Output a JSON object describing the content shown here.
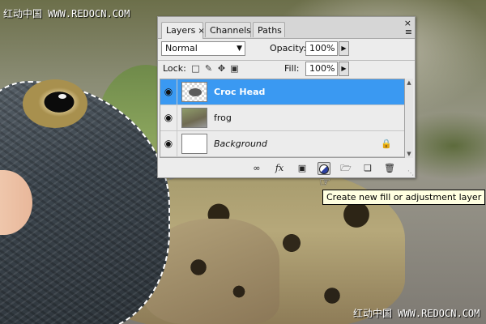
{
  "watermark": {
    "top": "红动中国 WWW.REDOCN.COM",
    "bottom": "红动中国 WWW.REDOCN.COM"
  },
  "tabs": [
    {
      "label": "Layers",
      "close": "×"
    },
    {
      "label": "Channels"
    },
    {
      "label": "Paths"
    }
  ],
  "panel_controls": {
    "collapse": "«",
    "close": "×",
    "menu": "≡"
  },
  "blend_mode": {
    "value": "Normal",
    "arrow": "▼"
  },
  "opacity": {
    "label": "Opacity:",
    "value": "100%",
    "arrow": "▶"
  },
  "lock": {
    "label": "Lock:",
    "icons": [
      "lock-transparent-icon",
      "lock-image-icon",
      "lock-position-icon",
      "lock-all-icon"
    ]
  },
  "fill": {
    "label": "Fill:",
    "value": "100%",
    "arrow": "▶"
  },
  "layers": [
    {
      "name": "Croc Head",
      "selected": true,
      "visible": true
    },
    {
      "name": "frog",
      "selected": false,
      "visible": true
    },
    {
      "name": "Background",
      "selected": false,
      "visible": true,
      "locked": true
    }
  ],
  "bottom_icons": [
    "link-layers-icon",
    "fx-icon",
    "layer-mask-icon",
    "adjustment-layer-icon",
    "new-group-icon",
    "new-layer-icon",
    "trash-icon"
  ],
  "tooltip": "Create new fill or adjustment layer",
  "colors": {
    "selection": "#3a99f2",
    "panel": "#ececec"
  }
}
